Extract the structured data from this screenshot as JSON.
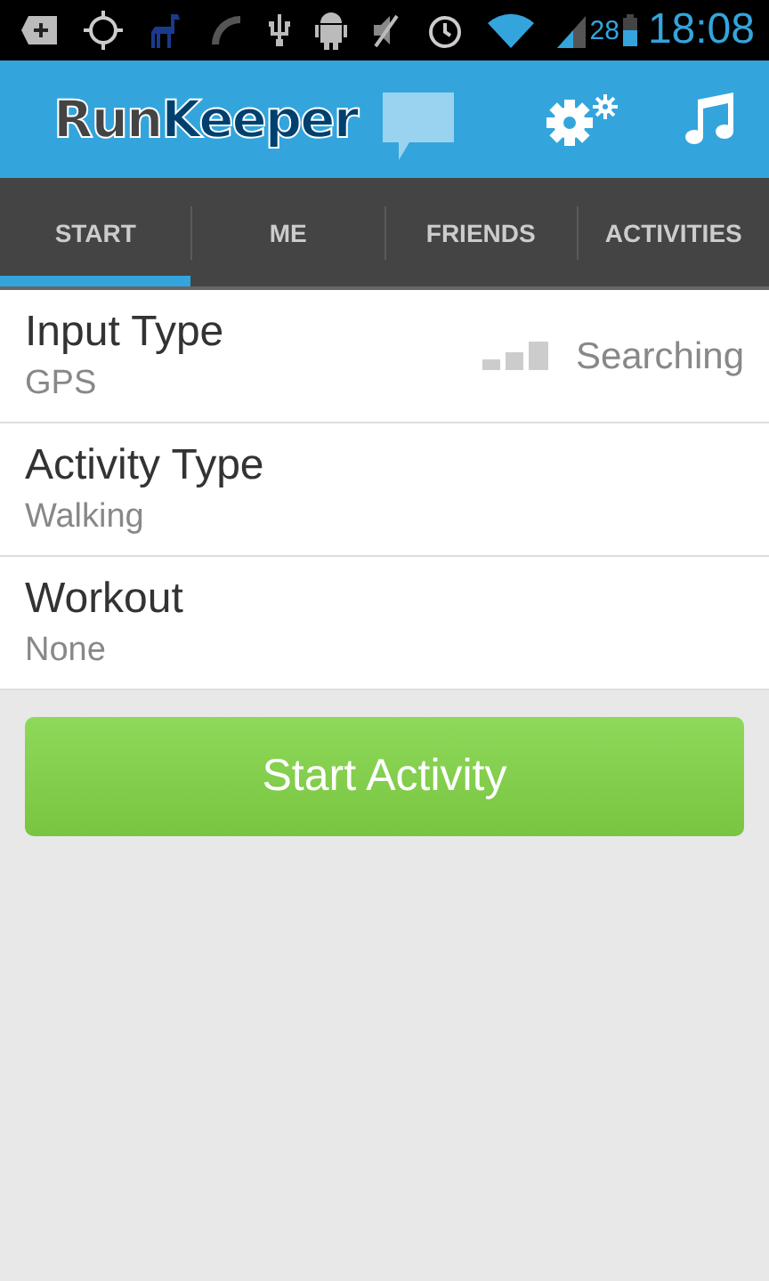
{
  "status_bar": {
    "battery": "28",
    "time": "18:08"
  },
  "header": {
    "logo_parts": [
      "Run",
      "Keeper"
    ]
  },
  "tabs": [
    {
      "label": "START",
      "selected": true
    },
    {
      "label": "ME",
      "selected": false
    },
    {
      "label": "FRIENDS",
      "selected": false
    },
    {
      "label": "ACTIVITIES",
      "selected": false
    }
  ],
  "settings": [
    {
      "label": "Input Type",
      "value": "GPS",
      "status": "Searching"
    },
    {
      "label": "Activity Type",
      "value": "Walking"
    },
    {
      "label": "Workout",
      "value": "None"
    }
  ],
  "start_button": "Start Activity"
}
